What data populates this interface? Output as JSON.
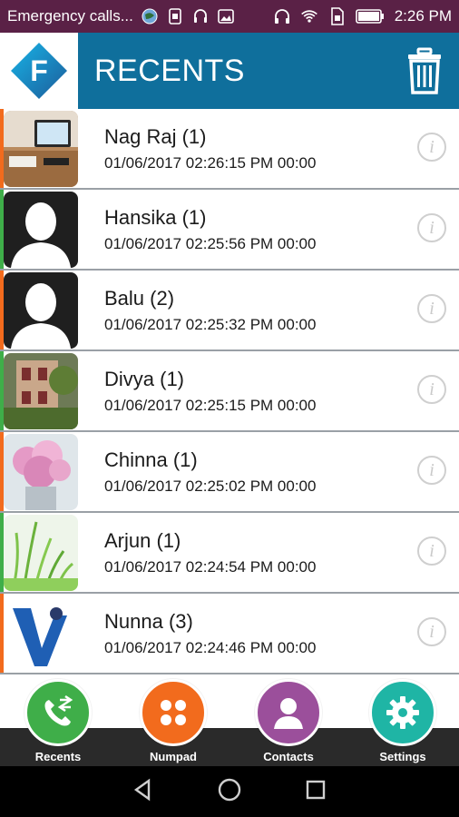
{
  "status_bar": {
    "notification_text": "Emergency calls...",
    "time": "2:26 PM",
    "icons": [
      "globe-icon",
      "sim-icon",
      "headset-icon",
      "image-icon",
      "headphones-icon",
      "wifi-icon",
      "sim-card-icon",
      "battery-icon"
    ]
  },
  "header": {
    "title": "RECENTS",
    "logo_letter": "F",
    "delete_icon": "trash-icon"
  },
  "recents": [
    {
      "name": "Nag Raj (1)",
      "datetime": "01/06/2017 02:26:15 PM 00:00",
      "stripe_color": "#f26b1d",
      "avatar": "photo-desk"
    },
    {
      "name": "Hansika (1)",
      "datetime": "01/06/2017 02:25:56 PM 00:00",
      "stripe_color": "#3fae49",
      "avatar": "placeholder-person"
    },
    {
      "name": "Balu (2)",
      "datetime": "01/06/2017 02:25:32 PM 00:00",
      "stripe_color": "#f26b1d",
      "avatar": "placeholder-person"
    },
    {
      "name": "Divya (1)",
      "datetime": "01/06/2017 02:25:15 PM 00:00",
      "stripe_color": "#3fae49",
      "avatar": "photo-building"
    },
    {
      "name": "Chinna (1)",
      "datetime": "01/06/2017 02:25:02 PM 00:00",
      "stripe_color": "#f26b1d",
      "avatar": "photo-flowers"
    },
    {
      "name": "Arjun (1)",
      "datetime": "01/06/2017 02:24:54 PM 00:00",
      "stripe_color": "#3fae49",
      "avatar": "photo-grass"
    },
    {
      "name": "Nunna (3)",
      "datetime": "01/06/2017 02:24:46 PM 00:00",
      "stripe_color": "#f26b1d",
      "avatar": "logo-v"
    }
  ],
  "bottom_nav": {
    "recents": {
      "label": "Recents",
      "color": "#3fae49"
    },
    "numpad": {
      "label": "Numpad",
      "color": "#f26b1d"
    },
    "contacts": {
      "label": "Contacts",
      "color": "#9b4f9b"
    },
    "settings": {
      "label": "Settings",
      "color": "#1fb5a5"
    }
  }
}
